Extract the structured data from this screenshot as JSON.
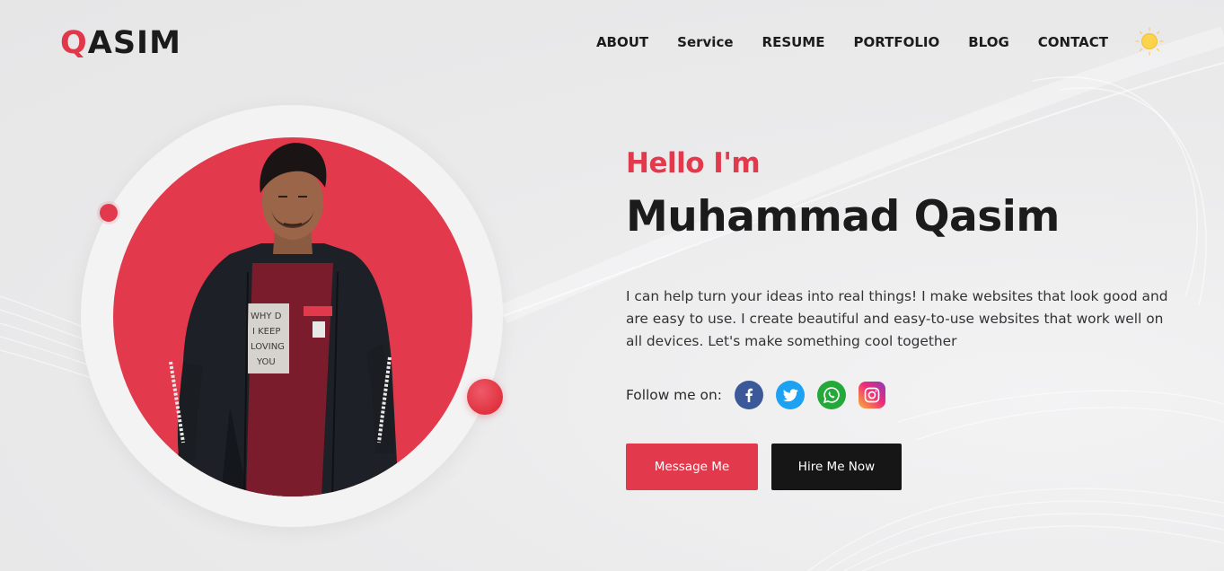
{
  "header": {
    "logo_first_letter": "Q",
    "logo_rest": "ASIM",
    "nav": [
      {
        "label": "ABOUT"
      },
      {
        "label": "Service"
      },
      {
        "label": "RESUME"
      },
      {
        "label": "PORTFOLIO"
      },
      {
        "label": "BLOG"
      },
      {
        "label": "CONTACT"
      }
    ],
    "theme_toggle_icon": "sun-icon"
  },
  "hero": {
    "greeting": "Hello I'm",
    "name": "Muhammad Qasim",
    "bio": "I can help turn your ideas into real things! I make websites that look good and are easy to use. I create beautiful and easy-to-use websites that work well on all devices. Let's make something cool together",
    "follow_label": "Follow me on:",
    "socials": [
      {
        "name": "facebook",
        "icon": "facebook-icon",
        "color": "#3b5998"
      },
      {
        "name": "twitter",
        "icon": "twitter-icon",
        "color": "#1da1f2"
      },
      {
        "name": "whatsapp",
        "icon": "whatsapp-icon",
        "color": "#25a83a"
      },
      {
        "name": "instagram",
        "icon": "instagram-icon",
        "color": "#ee2a7b"
      }
    ],
    "buttons": {
      "message": "Message Me",
      "hire": "Hire Me Now"
    },
    "photo_shirt_text": [
      "WHY D",
      "I KEEP",
      "LOVING",
      "YOU"
    ]
  },
  "colors": {
    "accent": "#e23a4c",
    "dark": "#161616",
    "background": "#eaeaeb"
  }
}
